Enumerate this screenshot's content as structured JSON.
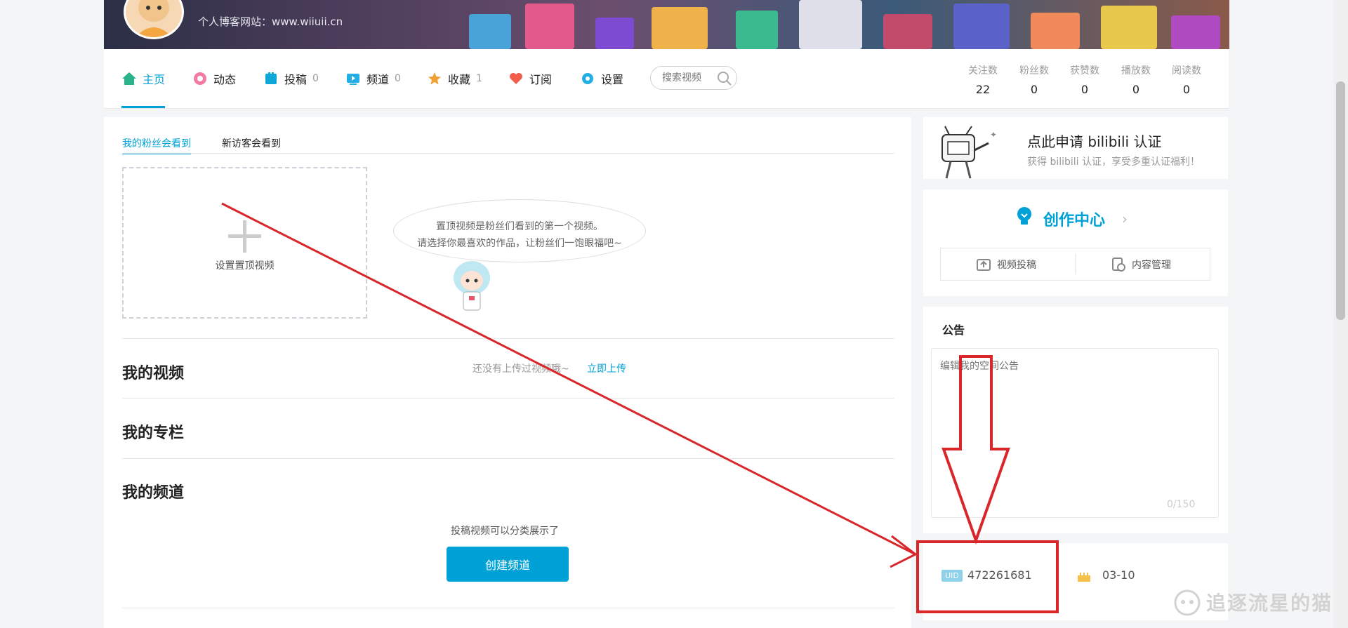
{
  "header": {
    "blog_text": "个人博客网站：www.wiiuii.cn"
  },
  "nav": {
    "items": [
      {
        "label": "主页",
        "count": ""
      },
      {
        "label": "动态",
        "count": ""
      },
      {
        "label": "投稿",
        "count": "0"
      },
      {
        "label": "频道",
        "count": "0"
      },
      {
        "label": "收藏",
        "count": "1"
      },
      {
        "label": "订阅",
        "count": ""
      },
      {
        "label": "设置",
        "count": ""
      }
    ],
    "search_placeholder": "搜索视频",
    "stats": [
      {
        "label": "关注数",
        "value": "22"
      },
      {
        "label": "粉丝数",
        "value": "0"
      },
      {
        "label": "获赞数",
        "value": "0"
      },
      {
        "label": "播放数",
        "value": "0"
      },
      {
        "label": "阅读数",
        "value": "0"
      }
    ]
  },
  "main": {
    "tabs": [
      "我的粉丝会看到",
      "新访客会看到"
    ],
    "pin_video_label": "设置置顶视频",
    "bubble_lines": [
      "置顶视频是粉丝们看到的第一个视频。",
      "请选择你最喜欢的作品，让粉丝们一饱眼福吧~"
    ],
    "sections": {
      "videos": "我的视频",
      "columns": "我的专栏",
      "channels": "我的频道"
    },
    "no_video_text": "还没有上传过视频哦~",
    "upload_link": "立即上传",
    "channel_tip": "投稿视频可以分类展示了",
    "create_channel_btn": "创建频道"
  },
  "sidebar": {
    "verify_title": "点此申请 bilibili 认证",
    "verify_subtitle": "获得 bilibili 认证，享受多重认证福利！",
    "creator_center": "创作中心",
    "creator_buttons": [
      "视频投稿",
      "内容管理"
    ],
    "notice_title": "公告",
    "notice_placeholder": "编辑我的空间公告",
    "notice_count": "0/150",
    "uid_badge": "UID",
    "uid_value": "472261681",
    "birthday": "03-10"
  },
  "watermark": "追逐流星的猫",
  "colors": {
    "accent": "#00a1d6",
    "annotation": "#d8262b"
  }
}
